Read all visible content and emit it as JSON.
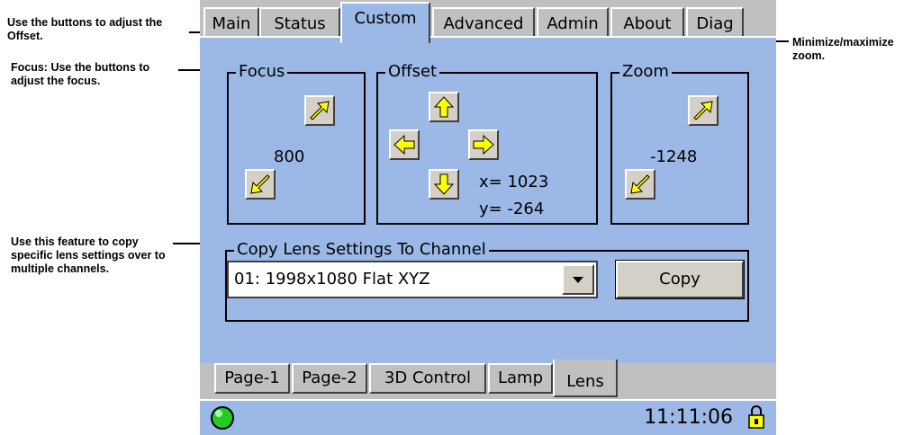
{
  "callouts": {
    "offset": "Use the buttons to adjust the Offset.",
    "focus": "Focus: Use the buttons to adjust the focus.",
    "zoom": "Minimize/maximize zoom.",
    "copy": "Use this feature to copy specific lens settings over to multiple channels."
  },
  "tabs_top": [
    "Main",
    "Status",
    "Custom",
    "Advanced",
    "Admin",
    "About",
    "Diag"
  ],
  "active_tab": "Custom",
  "focus": {
    "label": "Focus",
    "value": "800"
  },
  "offset": {
    "label": "Offset",
    "x": "x= 1023",
    "y": "y= -264"
  },
  "zoom": {
    "label": "Zoom",
    "value": "-1248"
  },
  "copy_group": {
    "label": "Copy Lens Settings To Channel",
    "selected": "01: 1998x1080  Flat XYZ",
    "button": "Copy"
  },
  "tabs_bottom": [
    "Page-1",
    "Page-2",
    "3D Control",
    "Lamp",
    "Lens"
  ],
  "active_bottom_tab": "Lens",
  "status": {
    "time": "11:11:06"
  },
  "colors": {
    "panel": "#9bb8e6",
    "button_yellow": "#ffff00",
    "status_led": "#22cc22"
  }
}
